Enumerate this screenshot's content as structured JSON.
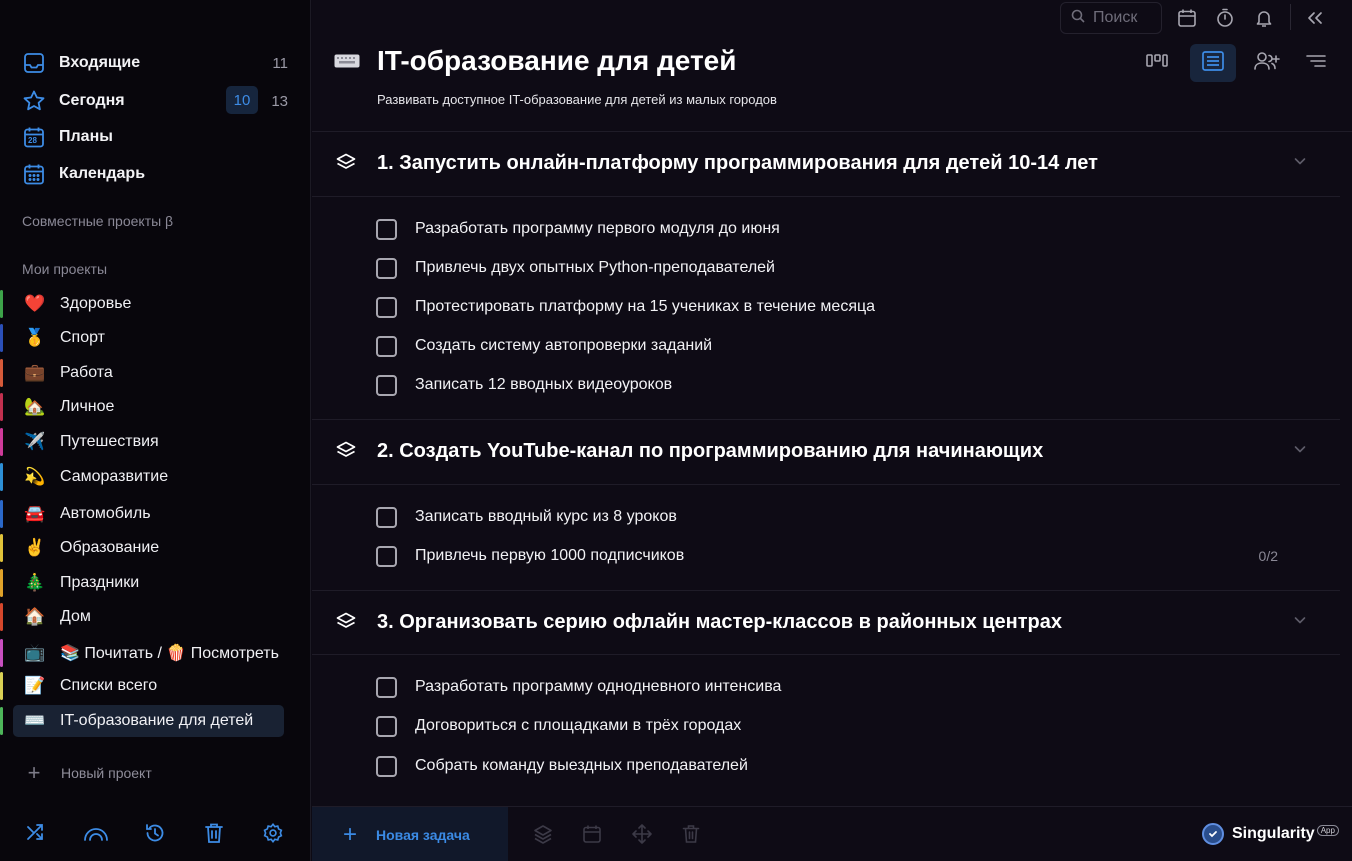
{
  "sidebar": {
    "nav": [
      {
        "label": "Входящие",
        "count": "11"
      },
      {
        "label": "Сегодня",
        "count_highlight": "10",
        "count": "13"
      },
      {
        "label": "Планы",
        "calendar_day": "28"
      },
      {
        "label": "Календарь"
      }
    ],
    "shared_title": "Совместные проекты β",
    "my_title": "Мои проекты",
    "projects": [
      {
        "emoji": "❤️",
        "label": "Здоровье",
        "color": "#3da34a"
      },
      {
        "emoji": "🥇",
        "label": "Спорт",
        "color": "#2b4fb8"
      },
      {
        "emoji": "💼",
        "label": "Работа",
        "color": "#d65a3a"
      },
      {
        "emoji": "🏡",
        "label": "Личное",
        "color": "#c2304f"
      },
      {
        "emoji": "✈️",
        "label": "Путешествия",
        "color": "#cf3b9a"
      },
      {
        "emoji": "💫",
        "label": "Саморазвитие",
        "color": "#2d8fd6"
      },
      {
        "emoji": "🚘",
        "label": "Автомобиль",
        "color": "#2b68c9"
      },
      {
        "emoji": "✌️",
        "label": "Образование",
        "color": "#e0c23a"
      },
      {
        "emoji": "🎄",
        "label": "Праздники",
        "color": "#e0a22a"
      },
      {
        "emoji": "🏠",
        "label": "Дом",
        "color": "#d5472c"
      },
      {
        "emoji": "📺",
        "label": "📚 Почитать / 🍿 Посмотреть",
        "color": "#c84fc0"
      },
      {
        "emoji": "📝",
        "label": "Списки всего",
        "color": "#d9d055"
      },
      {
        "emoji": "⌨️",
        "label": "IT-образование для детей",
        "color": "#4db55a"
      }
    ],
    "new_project": "Новый проект"
  },
  "topbar": {
    "search_placeholder": "Поиск"
  },
  "page": {
    "title": "IT-образование для детей",
    "subtitle": "Развивать доступное IT-образование для детей из малых городов"
  },
  "groups": [
    {
      "title": "1. Запустить онлайн-платформу программирования для детей 10-14 лет",
      "tasks": [
        {
          "label": "Разработать программу первого модуля до июня"
        },
        {
          "label": "Привлечь двух опытных Python-преподавателей"
        },
        {
          "label": "Протестировать платформу на 15 учениках в течение месяца"
        },
        {
          "label": "Создать систему автопроверки заданий"
        },
        {
          "label": "Записать 12 вводных видеоуроков"
        }
      ]
    },
    {
      "title": "2. Создать YouTube-канал по программированию для начинающих",
      "tasks": [
        {
          "label": "Записать вводный курс из 8 уроков"
        },
        {
          "label": "Привлечь первую 1000 подписчиков",
          "meta": "0/2"
        }
      ]
    },
    {
      "title": "3. Организовать серию офлайн мастер-классов в районных центрах",
      "tasks": [
        {
          "label": "Разработать программу однодневного интенсива"
        },
        {
          "label": "Договориться с площадками в трёх городах"
        },
        {
          "label": "Собрать команду выездных преподавателей"
        }
      ]
    }
  ],
  "bottom": {
    "new_task": "Новая задача",
    "brand": "Singularity",
    "brand_badge": "App"
  },
  "colors": {
    "accent": "#3b8ae4",
    "sidebar_bg": "#08060c",
    "main_bg": "#0e0b15"
  }
}
